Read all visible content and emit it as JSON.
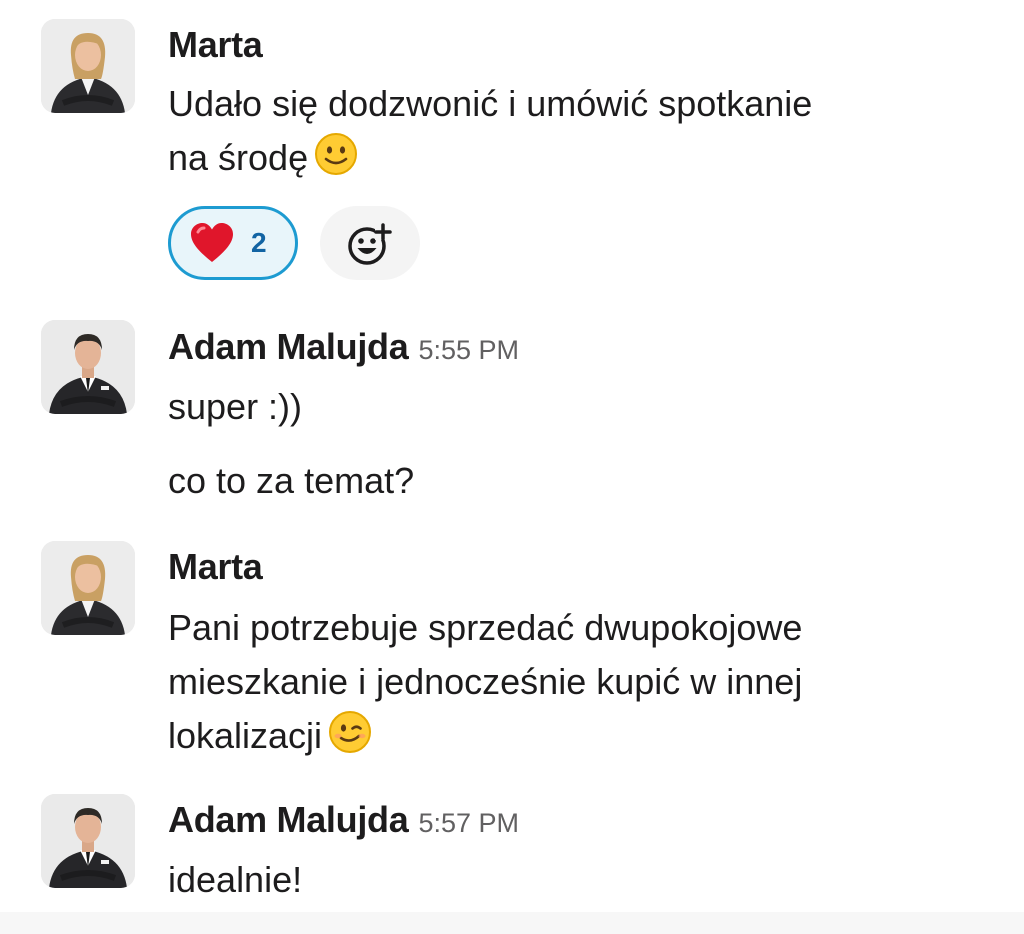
{
  "messages": [
    {
      "sender": "Marta",
      "time": "",
      "avatar_icon": "avatar-woman-photo",
      "lines": [
        "Udało się dodzwonić i umówić spotkanie",
        "na środę"
      ],
      "emoji": "slightly-smiling-face-icon",
      "reactions": [
        {
          "emoji": "red-heart-icon",
          "count": "2",
          "active": true
        }
      ],
      "add_reaction_icon": "add-reaction-icon"
    },
    {
      "sender": "Adam Malujda",
      "time": "5:55 PM",
      "avatar_icon": "avatar-man-photo",
      "lines": [
        "super :))",
        "co to za temat?"
      ]
    },
    {
      "sender": "Marta",
      "time": "",
      "avatar_icon": "avatar-woman-photo",
      "lines": [
        "Pani potrzebuje sprzedać dwupokojowe",
        "mieszkanie i jednocześnie kupić w innej",
        "lokalizacji"
      ],
      "emoji": "winking-face-icon"
    },
    {
      "sender": "Adam Malujda",
      "time": "5:57 PM",
      "avatar_icon": "avatar-man-photo",
      "lines": [
        "idealnie!"
      ]
    }
  ],
  "colors": {
    "reaction_border": "#1d9bd1",
    "reaction_bg": "#e8f5fa",
    "reaction_count": "#1264a3",
    "timestamp": "#616061"
  }
}
